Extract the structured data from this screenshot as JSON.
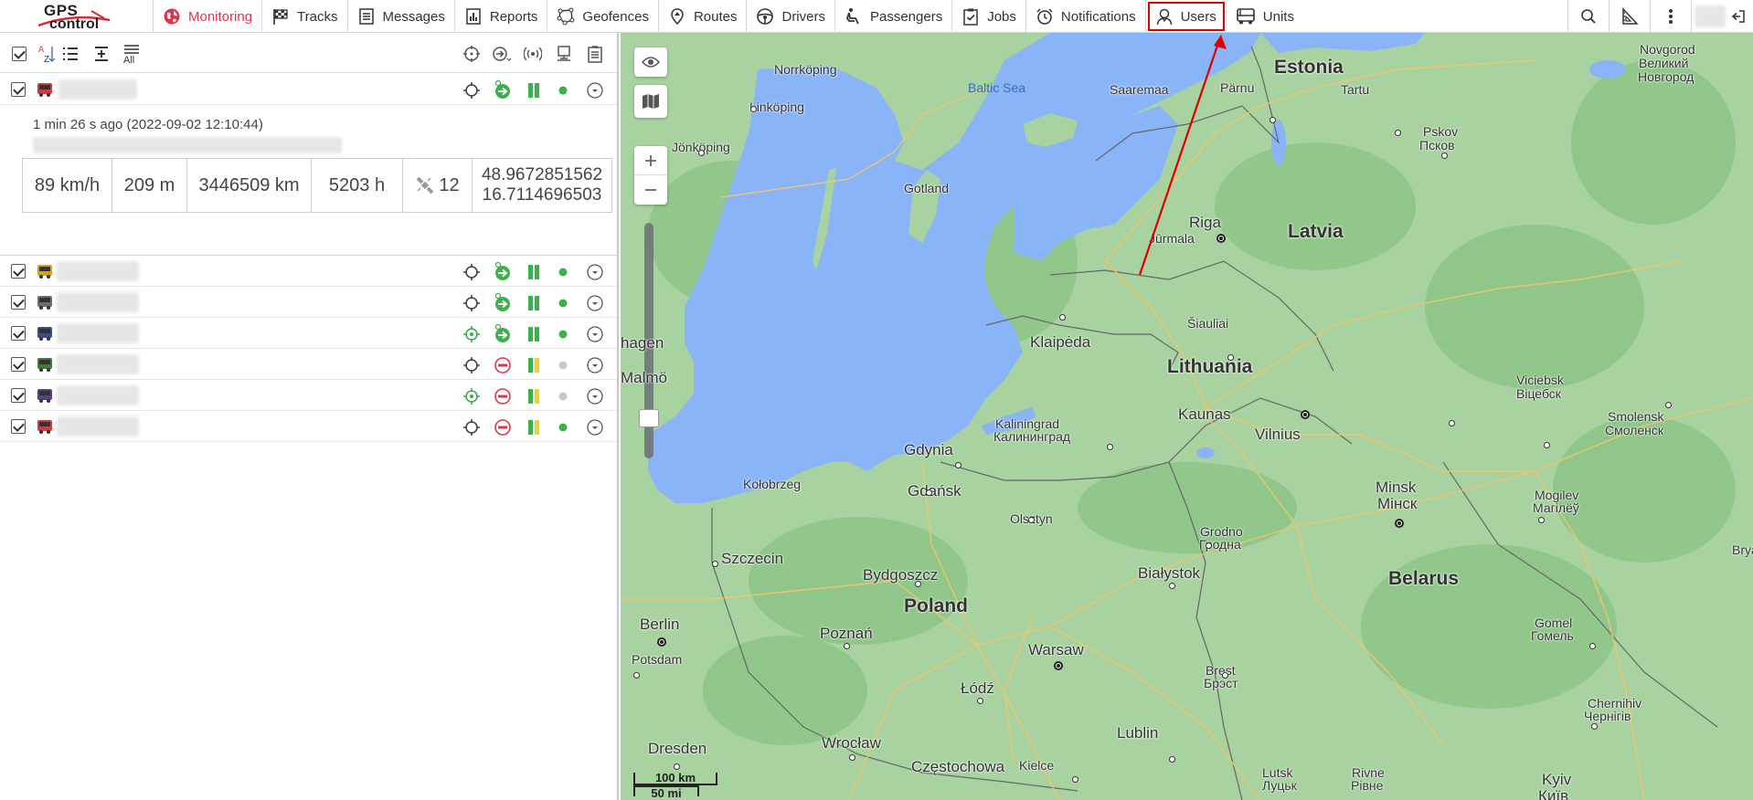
{
  "app": {
    "logo_line1": "GPS",
    "logo_line2": "control"
  },
  "nav": {
    "items": [
      {
        "label": "Monitoring",
        "icon": "globe-icon",
        "active": true
      },
      {
        "label": "Tracks",
        "icon": "checkered-flag-icon"
      },
      {
        "label": "Messages",
        "icon": "messages-icon"
      },
      {
        "label": "Reports",
        "icon": "reports-icon"
      },
      {
        "label": "Geofences",
        "icon": "geofence-icon"
      },
      {
        "label": "Routes",
        "icon": "route-icon"
      },
      {
        "label": "Drivers",
        "icon": "steering-wheel-icon"
      },
      {
        "label": "Passengers",
        "icon": "passenger-seat-icon"
      },
      {
        "label": "Jobs",
        "icon": "clipboard-icon"
      },
      {
        "label": "Notifications",
        "icon": "alarm-clock-icon"
      },
      {
        "label": "Users",
        "icon": "user-icon",
        "highlighted": true
      },
      {
        "label": "Units",
        "icon": "bus-icon"
      }
    ],
    "active_color": "#e0344a",
    "highlight_color": "#e00000"
  },
  "toolbar": {
    "all_label": "All",
    "sort_label_top": "A",
    "sort_label_bottom": "Z"
  },
  "units": {
    "selected": {
      "last_message": "1 min 26 s ago (2022-09-02 12:10:44)",
      "speed": "89 km/h",
      "altitude": "209 m",
      "mileage": "3446509 km",
      "engine_hours": "5203 h",
      "satellites": "12",
      "lat": "48.9672851562",
      "lon": "16.7114696503"
    },
    "rows": [
      {
        "color": "#d23b3b",
        "status_dot": "#3cb04a",
        "moving": true
      },
      {
        "color": "#d6a11a",
        "status_dot": "#3cb04a",
        "moving": true
      },
      {
        "color": "#6d6d6d",
        "status_dot": "#3cb04a",
        "moving": true
      },
      {
        "color": "#34508f",
        "status_dot": "#3cb04a",
        "moving": true
      },
      {
        "color": "#3a7a3a",
        "status_dot": "#c8c8c8",
        "moving": false
      },
      {
        "color": "#5e3d8f",
        "status_dot": "#c8c8c8",
        "moving": false
      },
      {
        "color": "#d23b3b",
        "status_dot": "#3cb04a",
        "moving": false
      }
    ]
  },
  "map": {
    "labels": {
      "estonia": "Estonia",
      "latvia": "Latvia",
      "lithuania": "Lithuania",
      "belarus": "Belarus",
      "poland": "Poland",
      "baltic_sea": "Baltic Sea",
      "norrkoping": "Norrköping",
      "linkoping": "Linköping",
      "jonkoping": "Jönköping",
      "gotland": "Gotland",
      "saaremaa": "Saaremaa",
      "parnu": "Pärnu",
      "tartu": "Tartu",
      "pskov": "Pskov",
      "pskov_ru": "Псков",
      "novgorod": "Novgorod",
      "novgorod_ru1": "Великий",
      "novgorod_ru2": "Новгород",
      "riga": "Riga",
      "jurmala": "Jūrmala",
      "siauliai": "Šiauliai",
      "klaipeda": "Klaipėda",
      "kaunas": "Kaunas",
      "vilnius": "Vilnius",
      "viciebsk": "Viciebsk",
      "viciebsk_ru": "Віцебск",
      "smolensk": "Smolensk",
      "smolensk_ru": "Смоленск",
      "kaliningrad": "Kaliningrad",
      "kaliningrad_ru": "Калининград",
      "gdynia": "Gdynia",
      "gdansk": "Gdańsk",
      "kolobrzeg": "Kołobrzeg",
      "olsztyn": "Olsztyn",
      "minsk": "Minsk",
      "minsk_ru": "Мінск",
      "mogilev": "Mogilev",
      "mogilev_ru": "Магілёў",
      "grodno": "Grodno",
      "grodno_ru": "Гродна",
      "szczecin": "Szczecin",
      "bydgoszcz": "Bydgoszcz",
      "bialystok": "Białystok",
      "berlin": "Berlin",
      "potsdam": "Potsdam",
      "poznan": "Poznań",
      "warsaw": "Warsaw",
      "brest": "Brest",
      "brest_ru": "Брэст",
      "lodz": "Łódź",
      "gomel": "Gomel",
      "gomel_ru": "Гомель",
      "dresden": "Dresden",
      "wroclaw": "Wrocław",
      "czestochowa": "Częstochowa",
      "kielce": "Kielce",
      "lublin": "Lublin",
      "lutsk": "Lutsk",
      "lutsk_ru": "Луцьк",
      "rivne": "Rivne",
      "rivne_ru": "Рівне",
      "chernihiv": "Chernihiv",
      "chernihiv_ru": "Чернігів",
      "kyiv": "Kyiv",
      "kyiv_ru": "Київ",
      "malmo": "Malmö",
      "hagen": "hagen",
      "brya": "Brya"
    },
    "scale_km": "100 km",
    "scale_mi": "50 mi",
    "water_color": "#8ab4f8",
    "land_color": "#a8d2a0"
  }
}
